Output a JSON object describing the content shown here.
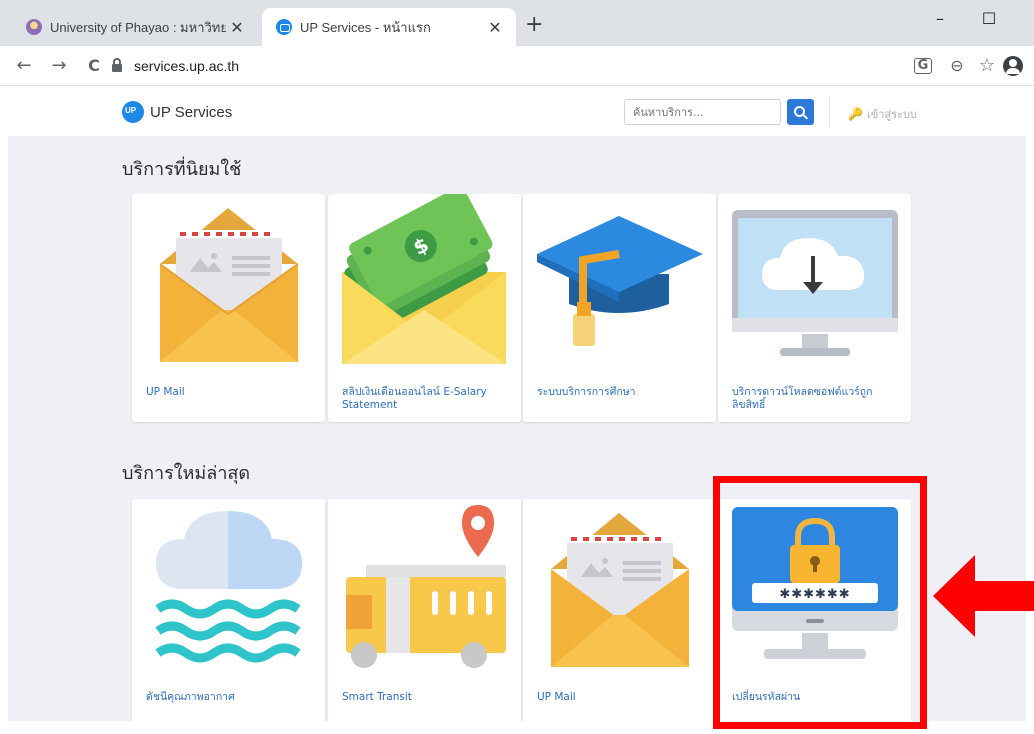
{
  "browser": {
    "tabs": [
      {
        "title": "University of Phayao : มหาวิทยาลัย",
        "close": "✕"
      },
      {
        "title": "UP Services - หน้าแรก",
        "close": "✕"
      }
    ],
    "new_tab": "+",
    "window_controls": {
      "minimize": "–",
      "maximize": "☐"
    },
    "nav": {
      "back": "←",
      "forward": "→",
      "reload": "C"
    },
    "url": "services.up.ac.th",
    "icons": [
      "translate-icon",
      "zoom-icon",
      "star-icon",
      "profile-icon"
    ],
    "toolbar_glyphs": {
      "translate": "G",
      "zoom": "⊖",
      "star": "☆"
    }
  },
  "site": {
    "brand": "UP Services",
    "search_placeholder": "ค้นหาบริการ...",
    "login_label": "เข้าสู่ระบบ",
    "key_glyph": "🔑"
  },
  "sections": [
    {
      "title": "บริการที่นิยมใช้",
      "cards": [
        {
          "label": "UP Mail",
          "icon": "mail-envelope-icon"
        },
        {
          "label": "สลิปเงินเดือนออนไลน์ E-Salary Statement",
          "icon": "salary-envelope-icon"
        },
        {
          "label": "ระบบบริการการศึกษา",
          "icon": "graduation-cap-icon"
        },
        {
          "label": "บริการดาวน์โหลดซอฟต์แวร์ถูกลิขสิทธิ์",
          "icon": "cloud-download-monitor-icon"
        }
      ]
    },
    {
      "title": "บริการใหม่ล่าสุด",
      "cards": [
        {
          "label": "ดัชนีคุณภาพอากาศ",
          "icon": "cloud-waves-icon"
        },
        {
          "label": "Smart Transit",
          "icon": "bus-location-icon"
        },
        {
          "label": "UP Mail",
          "icon": "mail-envelope-icon"
        },
        {
          "label": "เปลี่ยนรหัสผ่าน",
          "icon": "password-monitor-icon"
        }
      ]
    }
  ],
  "password_mask": "✱✱✱✱✱✱",
  "annotation": {
    "color": "#ff0000",
    "target": "เปลี่ยนรหัสผ่าน"
  },
  "colors": {
    "accent": "#2b78d8",
    "link": "#2f6db5",
    "page_bg": "#eef0f5"
  }
}
